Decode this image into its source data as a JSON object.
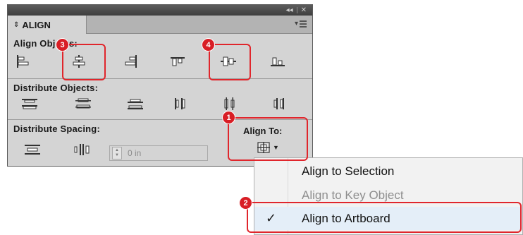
{
  "panel": {
    "title_controls": {
      "collapse": "◂◂",
      "close": "✕"
    },
    "tab_label": "ALIGN",
    "tab_chevron": "⇕",
    "align_objects_label": "Align Objects:",
    "distribute_objects_label": "Distribute Objects:",
    "distribute_spacing_label": "Distribute Spacing:",
    "spacing_value": "0 in",
    "align_to_label": "Align To:"
  },
  "menu": {
    "items": [
      {
        "label": "Align to Selection",
        "state": "enabled"
      },
      {
        "label": "Align to Key Object",
        "state": "disabled"
      },
      {
        "label": "Align to Artboard",
        "state": "checked",
        "check": "✓"
      }
    ]
  },
  "callouts": [
    "1",
    "2",
    "3",
    "4"
  ],
  "colors": {
    "callout": "#e0262c",
    "panel": "#d4d4d4",
    "titlebar": "#4a4a4a"
  },
  "icons": [
    "horizontal-align-left-icon",
    "horizontal-align-center-icon",
    "horizontal-align-right-icon",
    "vertical-align-top-icon",
    "vertical-align-center-icon",
    "vertical-align-bottom-icon",
    "vertical-distribute-top-icon",
    "vertical-distribute-center-icon",
    "vertical-distribute-bottom-icon",
    "horizontal-distribute-left-icon",
    "horizontal-distribute-center-icon",
    "horizontal-distribute-right-icon",
    "vertical-distribute-space-icon",
    "horizontal-distribute-space-icon",
    "align-to-artboard-icon"
  ]
}
